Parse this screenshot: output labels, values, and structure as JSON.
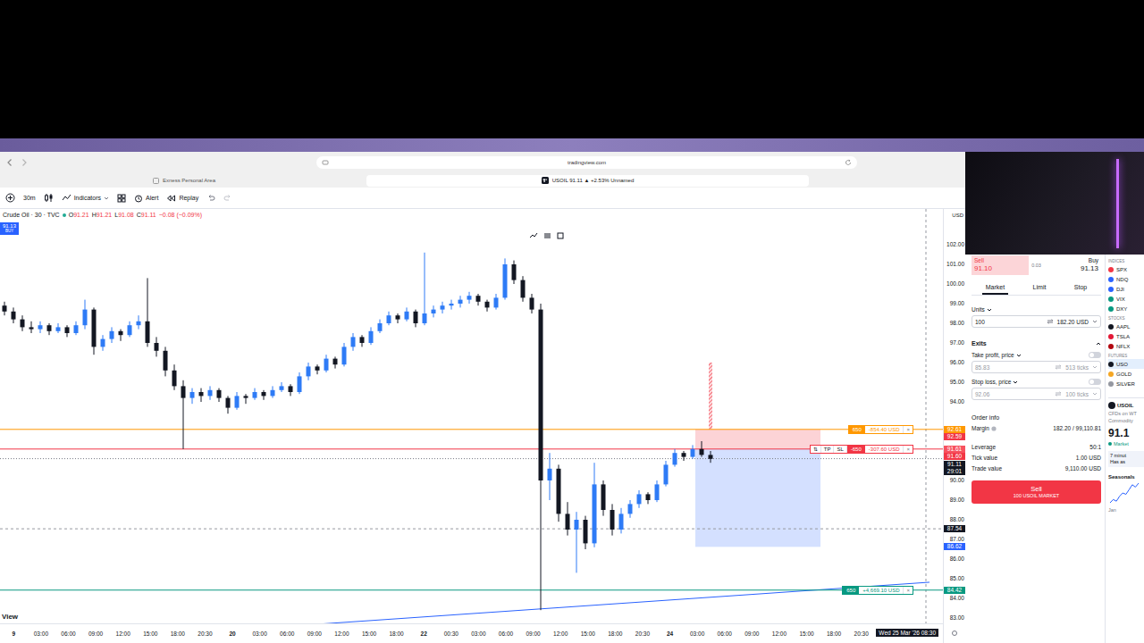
{
  "browser": {
    "url": "tradingview.com",
    "tabs": [
      {
        "label": "Exness Personal Area",
        "selected": false
      },
      {
        "label": "USOIL 91.11 ▲ +2.53% Unnamed",
        "selected": true
      }
    ]
  },
  "toolbar": {
    "interval": "30m",
    "buttons": [
      {
        "kind": "indicators",
        "label": "Indicators"
      },
      {
        "kind": "alert",
        "label": "Alert"
      },
      {
        "kind": "replay",
        "label": "Replay"
      }
    ]
  },
  "chart": {
    "legend": {
      "title": "Crude Oil · 30 · TVC",
      "marketOpen": true,
      "ohlc": [
        {
          "label": "O",
          "value": "91.21"
        },
        {
          "label": "H",
          "value": "91.21"
        },
        {
          "label": "L",
          "value": "91.08"
        },
        {
          "label": "C",
          "value": "91.11"
        }
      ],
      "change": "−0.08 (−0.09%)"
    },
    "buyBadge": {
      "price": "91.13",
      "label": "BUY"
    },
    "candles": [
      [
        98.9,
        99.1,
        98.4,
        98.6
      ],
      [
        98.6,
        98.8,
        98.0,
        98.2
      ],
      [
        98.2,
        98.4,
        97.6,
        97.8
      ],
      [
        97.8,
        98.1,
        97.5,
        97.7
      ],
      [
        97.7,
        98.1,
        97.5,
        97.9
      ],
      [
        97.9,
        98.0,
        97.4,
        97.6
      ],
      [
        97.6,
        98.0,
        97.5,
        97.8
      ],
      [
        97.8,
        97.9,
        97.3,
        97.5
      ],
      [
        97.5,
        98.1,
        97.4,
        97.9
      ],
      [
        97.9,
        99.2,
        97.7,
        98.7
      ],
      [
        98.7,
        98.8,
        96.4,
        96.8
      ],
      [
        96.8,
        97.4,
        96.6,
        97.2
      ],
      [
        97.2,
        97.8,
        97.0,
        97.6
      ],
      [
        97.6,
        97.7,
        97.1,
        97.4
      ],
      [
        97.4,
        98.1,
        97.3,
        97.9
      ],
      [
        97.9,
        98.4,
        97.7,
        98.1
      ],
      [
        98.1,
        100.3,
        96.8,
        97.0
      ],
      [
        97.0,
        97.3,
        96.3,
        96.6
      ],
      [
        96.6,
        96.8,
        95.3,
        95.6
      ],
      [
        95.6,
        95.9,
        94.6,
        94.8
      ],
      [
        94.8,
        95.1,
        91.6,
        94.2
      ],
      [
        94.2,
        94.7,
        93.9,
        94.5
      ],
      [
        94.5,
        94.7,
        94.0,
        94.3
      ],
      [
        94.3,
        94.8,
        94.1,
        94.6
      ],
      [
        94.6,
        94.7,
        94.0,
        94.2
      ],
      [
        94.2,
        94.3,
        93.4,
        93.7
      ],
      [
        93.7,
        94.5,
        93.6,
        94.3
      ],
      [
        94.3,
        94.4,
        93.9,
        94.2
      ],
      [
        94.2,
        94.7,
        94.1,
        94.5
      ],
      [
        94.5,
        94.6,
        94.1,
        94.3
      ],
      [
        94.3,
        94.8,
        94.2,
        94.6
      ],
      [
        94.6,
        95.0,
        94.5,
        94.8
      ],
      [
        94.8,
        94.9,
        94.3,
        94.5
      ],
      [
        94.5,
        95.5,
        94.4,
        95.3
      ],
      [
        95.3,
        96.0,
        95.1,
        95.8
      ],
      [
        95.8,
        95.9,
        95.4,
        95.6
      ],
      [
        95.6,
        96.4,
        95.5,
        96.2
      ],
      [
        96.2,
        96.3,
        95.7,
        95.9
      ],
      [
        95.9,
        97.0,
        95.8,
        96.8
      ],
      [
        96.8,
        97.5,
        96.6,
        97.3
      ],
      [
        97.3,
        97.4,
        96.8,
        97.0
      ],
      [
        97.0,
        97.8,
        96.9,
        97.6
      ],
      [
        97.6,
        98.2,
        97.5,
        98.0
      ],
      [
        98.0,
        98.6,
        97.9,
        98.4
      ],
      [
        98.4,
        98.5,
        98.0,
        98.2
      ],
      [
        98.2,
        98.8,
        98.1,
        98.6
      ],
      [
        98.6,
        98.7,
        97.8,
        98.0
      ],
      [
        98.0,
        101.6,
        97.9,
        98.5
      ],
      [
        98.5,
        98.9,
        98.3,
        98.7
      ],
      [
        98.7,
        99.1,
        98.5,
        98.9
      ],
      [
        98.9,
        99.2,
        98.7,
        99.0
      ],
      [
        99.0,
        99.4,
        98.8,
        99.2
      ],
      [
        99.2,
        99.6,
        99.0,
        99.4
      ],
      [
        99.4,
        99.5,
        98.9,
        99.1
      ],
      [
        99.1,
        99.2,
        98.6,
        98.8
      ],
      [
        98.8,
        99.5,
        98.7,
        99.3
      ],
      [
        99.3,
        101.3,
        99.2,
        101.0
      ],
      [
        101.0,
        101.2,
        100.0,
        100.2
      ],
      [
        100.2,
        100.4,
        99.1,
        99.3
      ],
      [
        99.3,
        99.5,
        98.5,
        98.7
      ],
      [
        98.7,
        99.0,
        83.4,
        90.0
      ],
      [
        90.0,
        91.4,
        89.0,
        90.6
      ],
      [
        90.6,
        90.8,
        87.9,
        88.3
      ],
      [
        88.3,
        88.9,
        87.2,
        87.5
      ],
      [
        87.5,
        88.4,
        85.3,
        88.0
      ],
      [
        88.0,
        88.2,
        86.5,
        86.8
      ],
      [
        86.8,
        90.9,
        86.6,
        89.8
      ],
      [
        89.8,
        90.0,
        88.2,
        88.5
      ],
      [
        88.5,
        88.8,
        87.2,
        87.5
      ],
      [
        87.5,
        88.6,
        87.3,
        88.3
      ],
      [
        88.3,
        89.0,
        88.1,
        88.8
      ],
      [
        88.8,
        89.5,
        88.6,
        89.3
      ],
      [
        89.3,
        89.4,
        88.8,
        89.0
      ],
      [
        89.0,
        90.0,
        88.9,
        89.8
      ],
      [
        89.8,
        91.0,
        89.7,
        90.8
      ],
      [
        90.8,
        91.6,
        90.7,
        91.4
      ],
      [
        91.4,
        91.5,
        91.0,
        91.2
      ],
      [
        91.2,
        91.8,
        91.1,
        91.6
      ],
      [
        91.6,
        92.0,
        91.2,
        91.3
      ],
      [
        91.3,
        91.5,
        90.9,
        91.1
      ]
    ],
    "lastPrice": 91.11,
    "crosshair": {
      "price": 87.54,
      "index": 103.1
    },
    "trendLine": {
      "start": {
        "index": 27.5,
        "price": 82.45
      },
      "end": {
        "index": 103.5,
        "price": 84.82
      }
    },
    "positionTool": {
      "startIndex": 77.3,
      "endIndex": 91.3,
      "stop": 92.6,
      "entry": 91.6,
      "target": 86.62
    },
    "signalBar": {
      "index": 79,
      "from": 96,
      "to": 92.6
    },
    "orderLines": [
      {
        "price": 92.6,
        "color": "#ff9800",
        "tags": [],
        "qty": "650",
        "pnl": "-854.40 USD",
        "close": "×"
      },
      {
        "price": 91.6,
        "color": "#f23645",
        "tags": [
          "⇅",
          "TP",
          "SL"
        ],
        "qty": "-650",
        "pnl": "-307.60 USD",
        "close": "×"
      },
      {
        "price": 84.42,
        "color": "#089981",
        "tags": [],
        "qty": "650",
        "pnl": "+4,669.10 USD",
        "close": "×"
      }
    ],
    "currency": "USD",
    "priceTicks": [
      "102.00",
      "101.00",
      "100.00",
      "99.00",
      "98.00",
      "97.00",
      "96.00",
      "95.00",
      "94.00",
      "90.00",
      "89.00",
      "88.00",
      "87.00",
      "86.00",
      "85.00",
      "84.00",
      "83.00"
    ],
    "axisLabels": [
      {
        "text": "92.61",
        "price": 92.61,
        "color": "#ff9800"
      },
      {
        "text": "92.59",
        "price": 92.59,
        "color": "#f23645"
      },
      {
        "text": "91.61",
        "price": 91.61,
        "color": "#f7525f"
      },
      {
        "text": "91.60",
        "price": 91.6,
        "color": "#f23645"
      },
      {
        "text": "91.11",
        "price": 91.11,
        "color": "#131722"
      },
      {
        "text": "29:01",
        "price": 91.11,
        "color": "#131722"
      },
      {
        "text": "87.54",
        "price": 87.54,
        "color": "#131722"
      },
      {
        "text": "86.62",
        "price": 86.62,
        "color": "#2962ff"
      },
      {
        "text": "84.42",
        "price": 84.42,
        "color": "#089981"
      }
    ],
    "timeLabels": [
      {
        "text": "9",
        "kind": "day"
      },
      {
        "text": "03:00",
        "kind": "time"
      },
      {
        "text": "06:00",
        "kind": "time"
      },
      {
        "text": "09:00",
        "kind": "time"
      },
      {
        "text": "12:00",
        "kind": "time"
      },
      {
        "text": "15:00",
        "kind": "time"
      },
      {
        "text": "18:00",
        "kind": "time"
      },
      {
        "text": "20:30",
        "kind": "time"
      },
      {
        "text": "20",
        "kind": "day"
      },
      {
        "text": "03:00",
        "kind": "time"
      },
      {
        "text": "06:00",
        "kind": "time"
      },
      {
        "text": "09:00",
        "kind": "time"
      },
      {
        "text": "12:00",
        "kind": "time"
      },
      {
        "text": "15:00",
        "kind": "time"
      },
      {
        "text": "18:00",
        "kind": "time"
      },
      {
        "text": "22",
        "kind": "day"
      },
      {
        "text": "00:30",
        "kind": "time"
      },
      {
        "text": "03:00",
        "kind": "time"
      },
      {
        "text": "06:00",
        "kind": "time"
      },
      {
        "text": "09:00",
        "kind": "time"
      },
      {
        "text": "12:00",
        "kind": "time"
      },
      {
        "text": "15:00",
        "kind": "time"
      },
      {
        "text": "18:00",
        "kind": "time"
      },
      {
        "text": "20:30",
        "kind": "time"
      },
      {
        "text": "24",
        "kind": "day"
      },
      {
        "text": "03:00",
        "kind": "time"
      },
      {
        "text": "06:00",
        "kind": "time"
      },
      {
        "text": "09:00",
        "kind": "time"
      },
      {
        "text": "12:00",
        "kind": "time"
      },
      {
        "text": "15:00",
        "kind": "time"
      },
      {
        "text": "18:00",
        "kind": "time"
      },
      {
        "text": "20:30",
        "kind": "time"
      }
    ],
    "crosshairTime": "Wed 25 Mar '26 08:30",
    "footer": "View"
  },
  "trade": {
    "sell": {
      "label": "Sell",
      "price": "91.10"
    },
    "spread": "0.03",
    "buy": {
      "label": "Buy",
      "price": "91.13"
    },
    "orderTypes": [
      {
        "label": "Market",
        "selected": true
      },
      {
        "label": "Limit",
        "selected": false
      },
      {
        "label": "Stop",
        "selected": false
      }
    ],
    "units": {
      "label": "Units",
      "value": "100",
      "amount": "182.20 USD"
    },
    "exits": {
      "title": "Exits",
      "expanded": true,
      "rows": [
        {
          "label": "Take profit, price",
          "enabled": false,
          "price": "85.83",
          "ticks": "513 ticks"
        },
        {
          "label": "Stop loss, price",
          "enabled": false,
          "price": "92.06",
          "ticks": "100 ticks"
        }
      ]
    },
    "orderInfo": {
      "title": "Order info",
      "margin": {
        "label": "Margin",
        "value": "182.20 / 99,110.81"
      },
      "rows": [
        {
          "label": "Leverage",
          "value": "50:1"
        },
        {
          "label": "Tick value",
          "value": "1.00 USD"
        },
        {
          "label": "Trade value",
          "value": "9,110.00 USD"
        }
      ]
    },
    "submit": {
      "label": "Sell",
      "detail": "100 USOIL MARKET"
    }
  },
  "watchlist": {
    "groups": [
      {
        "title": "INDICES",
        "rows": [
          {
            "symbol": "SPX",
            "color": "#f23645",
            "selected": false
          },
          {
            "symbol": "NDQ",
            "color": "#2962ff",
            "selected": false
          },
          {
            "symbol": "DJI",
            "color": "#2962ff",
            "selected": false
          },
          {
            "symbol": "VIX",
            "color": "#089981",
            "selected": false
          },
          {
            "symbol": "DXY",
            "color": "#089981",
            "selected": false
          }
        ]
      },
      {
        "title": "STOCKS",
        "rows": [
          {
            "symbol": "AAPL",
            "color": "#131722",
            "selected": false
          },
          {
            "symbol": "TSLA",
            "color": "#e31937",
            "selected": false
          },
          {
            "symbol": "NFLX",
            "color": "#b20710",
            "selected": false
          }
        ]
      },
      {
        "title": "FUTURES",
        "rows": [
          {
            "symbol": "USO",
            "color": "#131722",
            "selected": true
          },
          {
            "symbol": "GOLD",
            "color": "#f5a623",
            "selected": false
          },
          {
            "symbol": "SILVER",
            "color": "#9598a1",
            "selected": false
          }
        ]
      }
    ],
    "card": {
      "symbol": "USOIL",
      "name": "CFDs on WT",
      "type": "Commodity",
      "price": "91.1",
      "status": "Market",
      "statusOpen": true,
      "note": [
        "7 minut",
        "Has as"
      ],
      "seasonals": {
        "title": "Seasonals",
        "values": [
          2,
          3,
          2.5,
          4,
          5,
          4.6,
          6,
          7.5,
          6.8,
          8
        ],
        "tick": "Jan"
      }
    }
  }
}
